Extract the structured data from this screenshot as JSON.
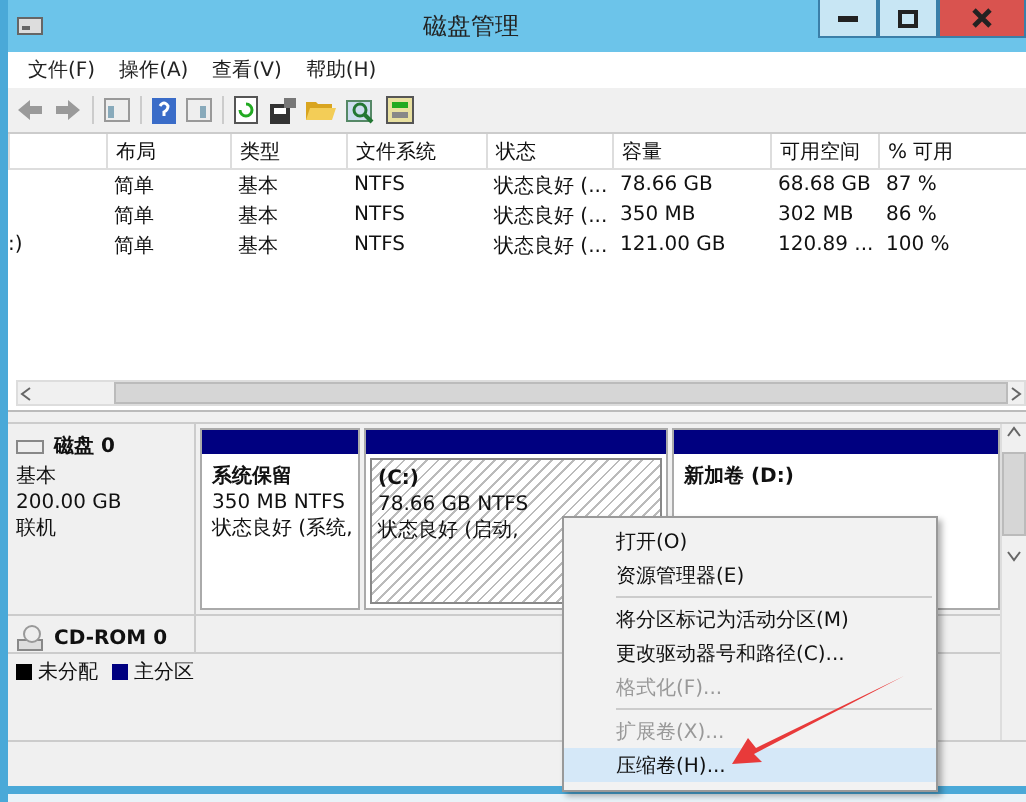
{
  "window": {
    "title": "磁盘管理"
  },
  "menu": [
    "文件(F)",
    "操作(A)",
    "查看(V)",
    "帮助(H)"
  ],
  "table": {
    "columns": [
      "布局",
      "类型",
      "文件系统",
      "状态",
      "容量",
      "可用空间",
      "% 可用"
    ],
    "rows": [
      {
        "cells": [
          "简单",
          "基本",
          "NTFS",
          "状态良好 (...",
          "78.66 GB",
          "68.68 GB",
          "87 %"
        ]
      },
      {
        "cells": [
          "简单",
          "基本",
          "NTFS",
          "状态良好 (...",
          "350 MB",
          "302 MB",
          "86 %"
        ]
      },
      {
        "volume": ":)",
        "cells": [
          "简单",
          "基本",
          "NTFS",
          "状态良好 (...",
          "121.00 GB",
          "120.89 ...",
          "100 %"
        ]
      }
    ]
  },
  "disks": [
    {
      "kind": "disk",
      "name": "磁盘 0",
      "type": "基本",
      "size": "200.00 GB",
      "status": "联机",
      "partitions": [
        {
          "name": "系统保留",
          "size": "350 MB NTFS",
          "status": "状态良好 (系统,",
          "selected": false
        },
        {
          "name": "(C:)",
          "size": "78.66 GB NTFS",
          "status": "状态良好 (启动,",
          "selected": true
        },
        {
          "name": "新加卷  (D:)",
          "selected": false
        }
      ]
    },
    {
      "kind": "cdrom",
      "name": "CD-ROM 0"
    }
  ],
  "legend": [
    {
      "label": "未分配",
      "color": "#000000"
    },
    {
      "label": "主分区",
      "color": "#000080"
    }
  ],
  "context_menu": [
    {
      "kind": "item",
      "label": "打开(O)",
      "disabled": false,
      "selected": false
    },
    {
      "kind": "item",
      "label": "资源管理器(E)",
      "disabled": false,
      "selected": false
    },
    {
      "kind": "separator"
    },
    {
      "kind": "item",
      "label": "将分区标记为活动分区(M)",
      "disabled": false,
      "selected": false
    },
    {
      "kind": "item",
      "label": "更改驱动器号和路径(C)...",
      "disabled": false,
      "selected": false
    },
    {
      "kind": "item",
      "label": "格式化(F)...",
      "disabled": true,
      "selected": false
    },
    {
      "kind": "separator"
    },
    {
      "kind": "item",
      "label": "扩展卷(X)...",
      "disabled": true,
      "selected": false
    },
    {
      "kind": "item",
      "label": "压缩卷(H)...",
      "disabled": false,
      "selected": true
    }
  ]
}
